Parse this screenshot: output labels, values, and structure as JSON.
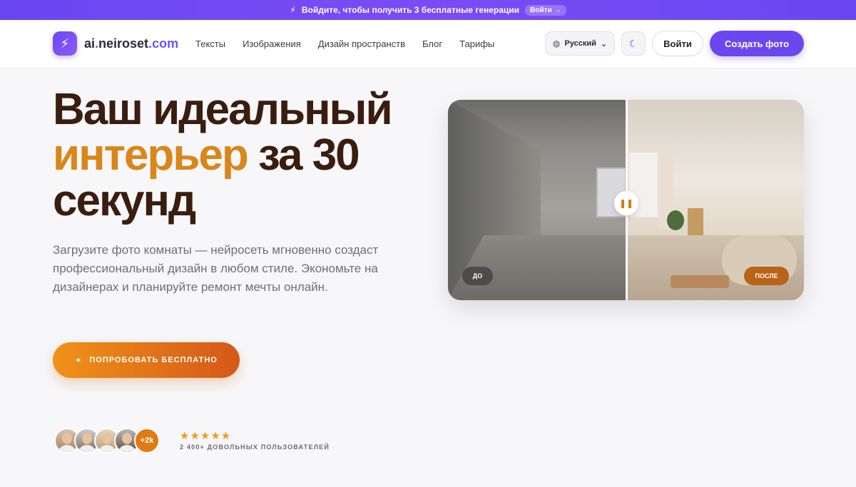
{
  "banner": {
    "text": "Войдите, чтобы получить 3 бесплатные генерации",
    "button": "Войти",
    "button_arrow": "→",
    "icon": "lightning-icon"
  },
  "header": {
    "logo": {
      "prefix": "ai",
      "dot": ".",
      "brand": "neiroset",
      "tld": ".com",
      "icon": "lightning-icon"
    },
    "nav": [
      "Тексты",
      "Изображения",
      "Дизайн пространств",
      "Блог",
      "Тарифы"
    ],
    "language": "Русский",
    "login": "Войти",
    "create": "Создать фото"
  },
  "hero": {
    "title_line1": "Ваш идеальный",
    "title_accent": "интерьер",
    "title_line2_rest": "за 30",
    "title_line3": "секунд",
    "subtitle": "Загрузите фото комнаты — нейросеть мгновенно создаст профессиональный дизайн в любом стиле. Экономьте на дизайнерах и планируйте ремонт мечты онлайн.",
    "cta": "ПОПРОБОВАТЬ БЕСПЛАТНО",
    "social": {
      "more": "+2k",
      "stars": "★★★★★",
      "users": "2 400+ ДОВОЛЬНЫХ ПОЛЬЗОВАТЕЛЕЙ"
    }
  },
  "compare": {
    "before": "ДО",
    "after": "ПОСЛЕ",
    "handle": "❚❚"
  },
  "colors": {
    "brand": "#6a47ef",
    "accent": "#d9861a",
    "heading": "#3a1d0e"
  }
}
